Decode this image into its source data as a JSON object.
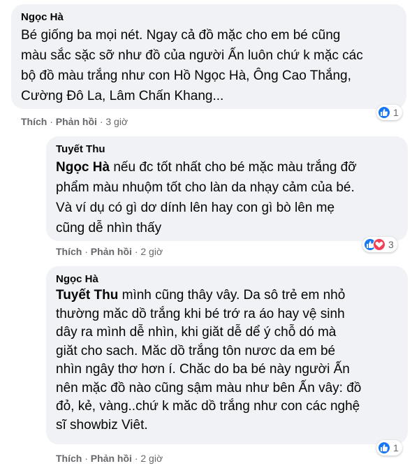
{
  "comments": [
    {
      "author": "Ngọc Hà",
      "lines": [
        "Bé giống ba mọi nét. Ngay cả đồ mặc cho em bé cũng",
        "màu sắc sặc sỡ như đồ của người Ấn luôn chứ k mặc các",
        "bộ đồ màu trắng như con Hồ Ngọc Hà, Ông Cao Thắng,",
        "Cường Đô La, Lâm Chấn Khang..."
      ],
      "like_label": "Thích",
      "reply_label": "Phản hồi",
      "time": "3 giờ",
      "reaction_count": "1"
    },
    {
      "author": "Tuyết Thu",
      "mention": "Ngọc Hà",
      "lines": [
        " nếu đc tốt nhất cho bé mặc màu trắng đỡ",
        "phẩm màu nhuộm tốt cho làn da nhạy cảm của bé.",
        "Và ví dụ có gì dơ dính lên hay con gì bò lên mẹ",
        "cũng dễ nhìn thấy"
      ],
      "like_label": "Thích",
      "reply_label": "Phản hồi",
      "time": "2 giờ",
      "reaction_count": "3"
    },
    {
      "author": "Ngọc Hà",
      "mention": "Tuyết Thu",
      "lines": [
        " mình cũng thây vây. Da sô trẻ em nhỏ",
        "thường măc dồ trắng khi bé trớ ra áo hay vệ sinh",
        "dây ra mình dễ nhìn, khi giăt dễ dể ý chỗ dó mà",
        "giăt cho sach. Măc dồ trắng tôn nươc da em bé",
        "nhìn ngây thơ hơn í. Chăc do ba bé này người Ấn",
        "nên mặc đồ nào cũng sậm màu như bên Ấn vây: đồ",
        "đỏ, kẻ, vàng..chứ k măc dồ trắng như con các nghệ",
        "sĩ showbiz Viêt."
      ],
      "like_label": "Thích",
      "reply_label": "Phản hồi",
      "time": "2 giờ",
      "reaction_count": "1"
    }
  ],
  "sep": "·",
  "icons": {
    "like": "like-reaction-icon",
    "love": "love-reaction-icon"
  },
  "colors": {
    "like": "#1877f2",
    "love": "#f33e58",
    "bubble": "#f0f2f5",
    "meta": "#65676b"
  }
}
